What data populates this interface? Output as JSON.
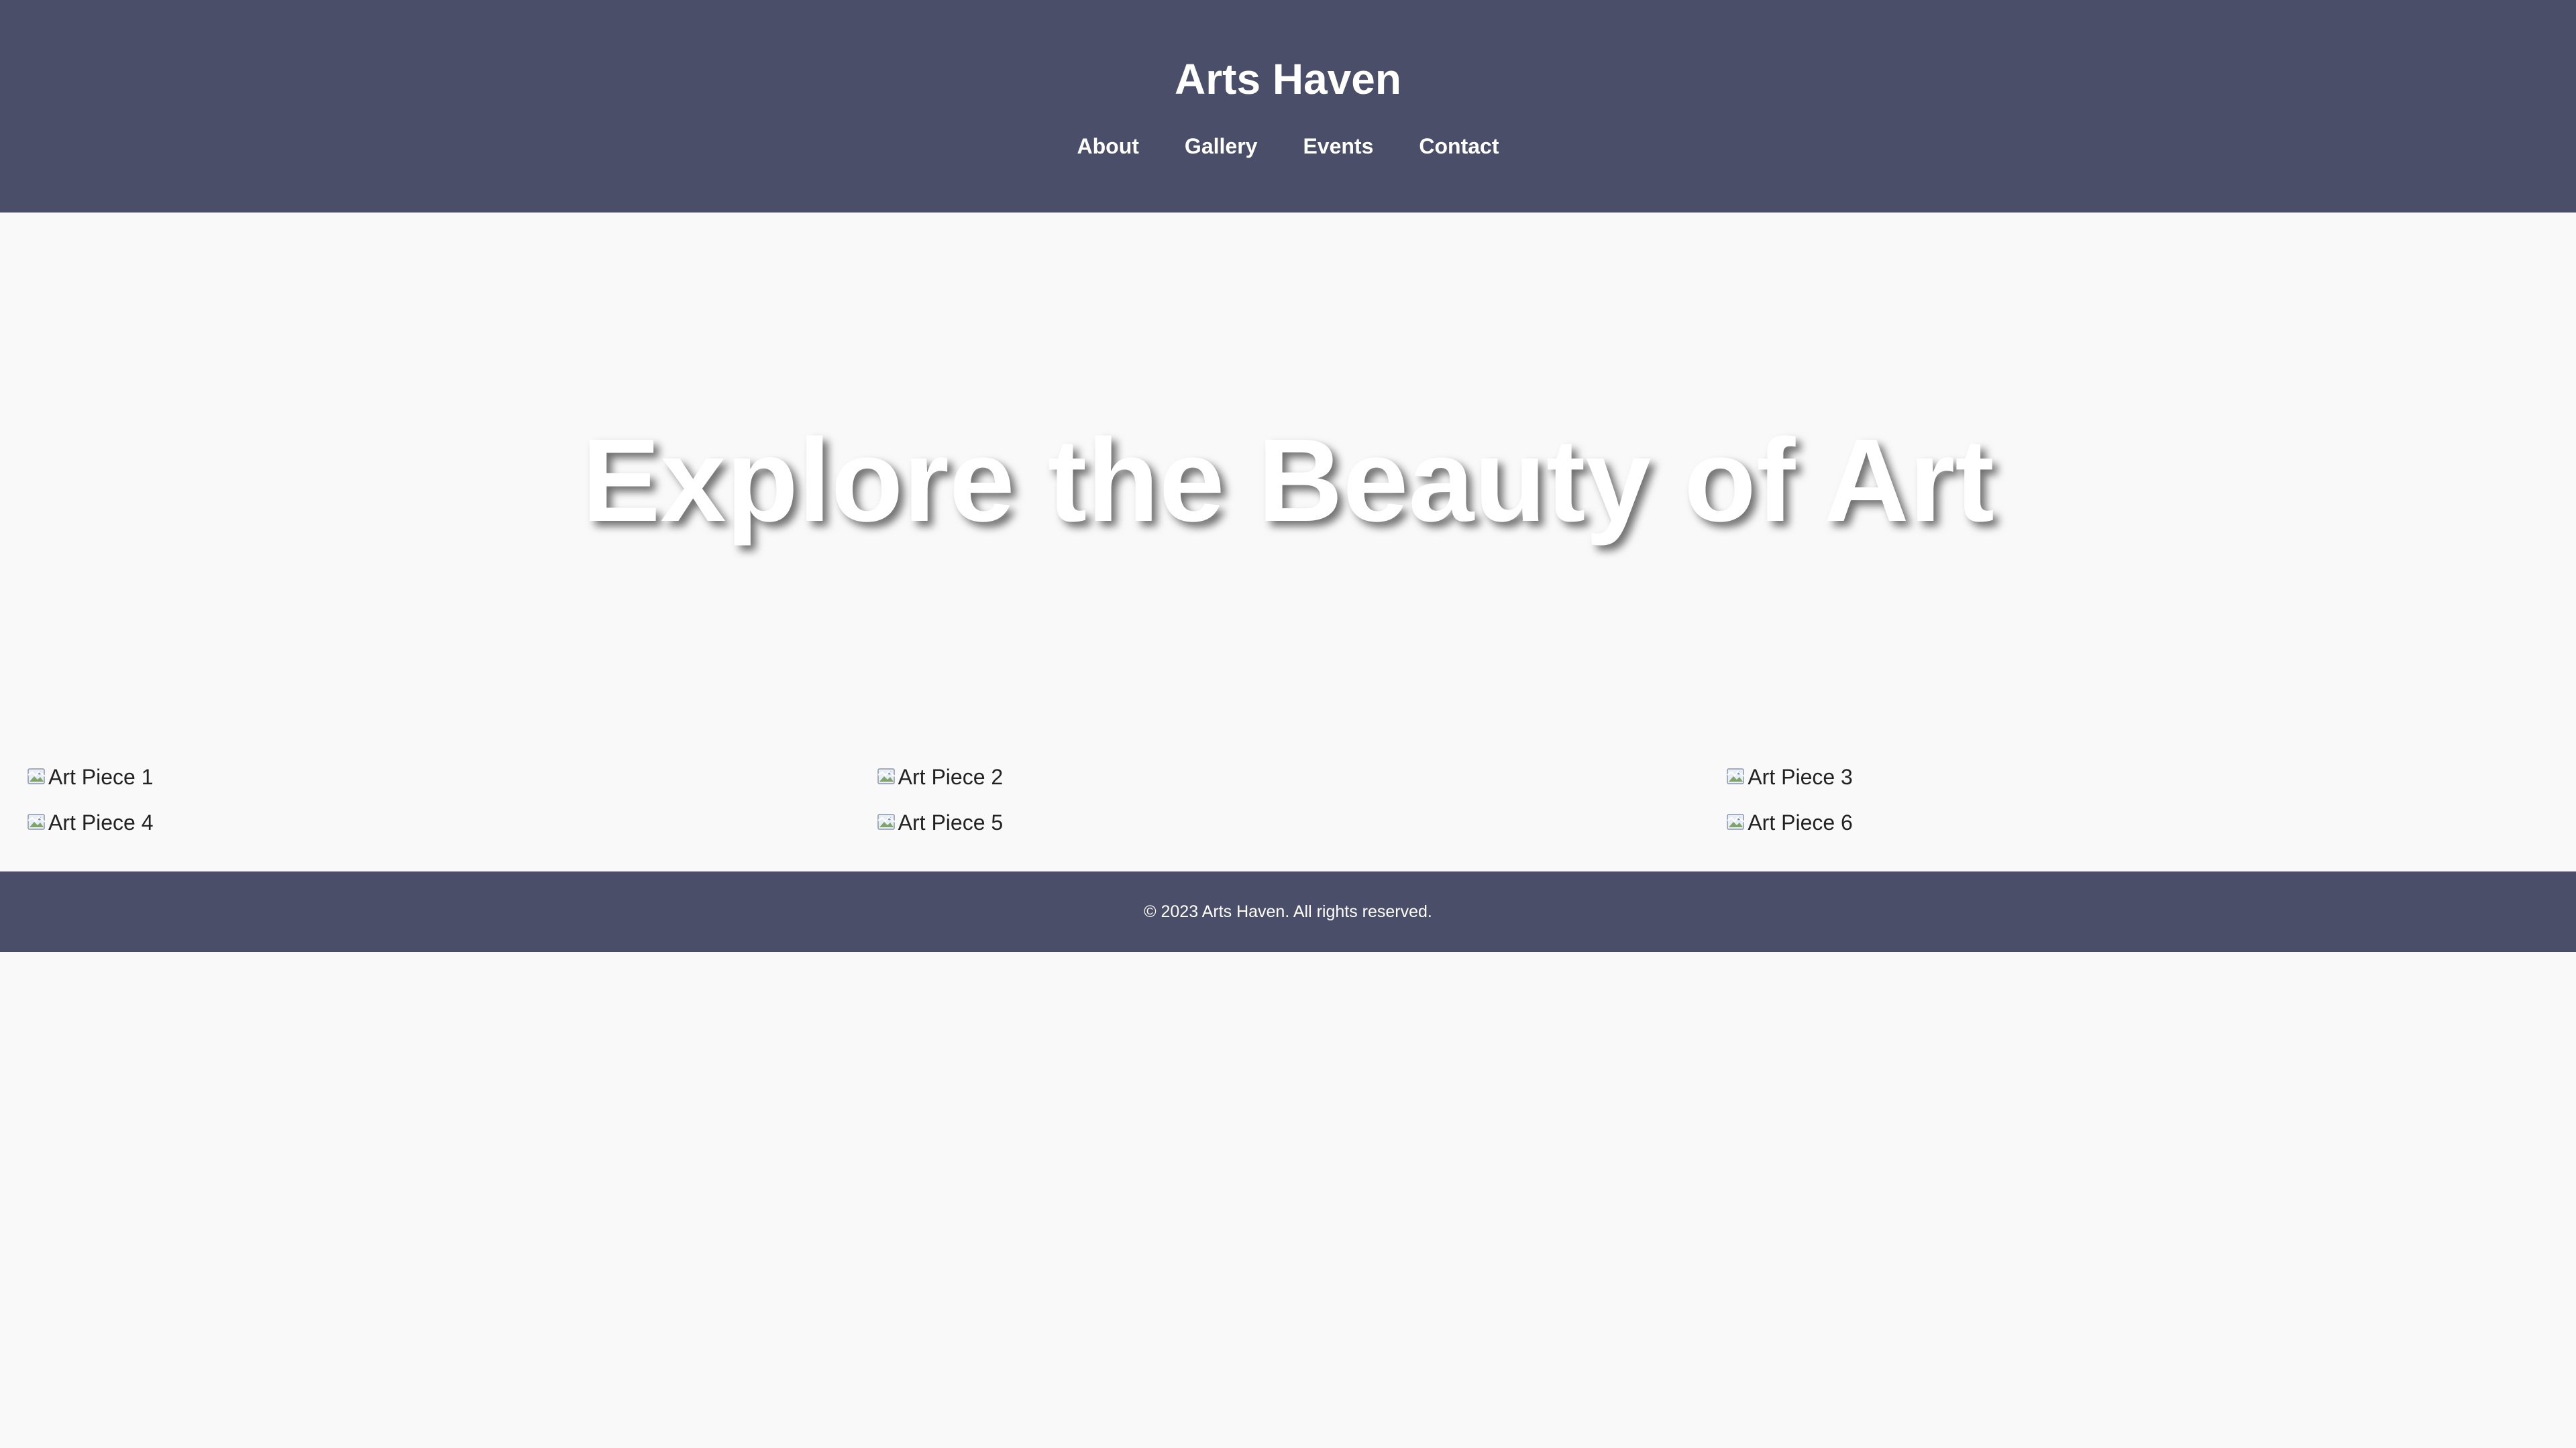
{
  "header": {
    "title": "Arts Haven",
    "nav": [
      {
        "label": "About"
      },
      {
        "label": "Gallery"
      },
      {
        "label": "Events"
      },
      {
        "label": "Contact"
      }
    ]
  },
  "hero": {
    "title": "Explore the Beauty of Art"
  },
  "gallery": {
    "items": [
      {
        "alt": "Art Piece 1",
        "icon": "broken-image-icon"
      },
      {
        "alt": "Art Piece 2",
        "icon": "broken-image-icon"
      },
      {
        "alt": "Art Piece 3",
        "icon": "broken-image-icon"
      },
      {
        "alt": "Art Piece 4",
        "icon": "broken-image-icon"
      },
      {
        "alt": "Art Piece 5",
        "icon": "broken-image-icon"
      },
      {
        "alt": "Art Piece 6",
        "icon": "broken-image-icon"
      }
    ]
  },
  "footer": {
    "text": "© 2023 Arts Haven. All rights reserved."
  },
  "colors": {
    "header_bg": "#4a4e69",
    "page_bg": "#f9f9f9",
    "text_light": "#ffffff",
    "text_dark": "#222222"
  }
}
